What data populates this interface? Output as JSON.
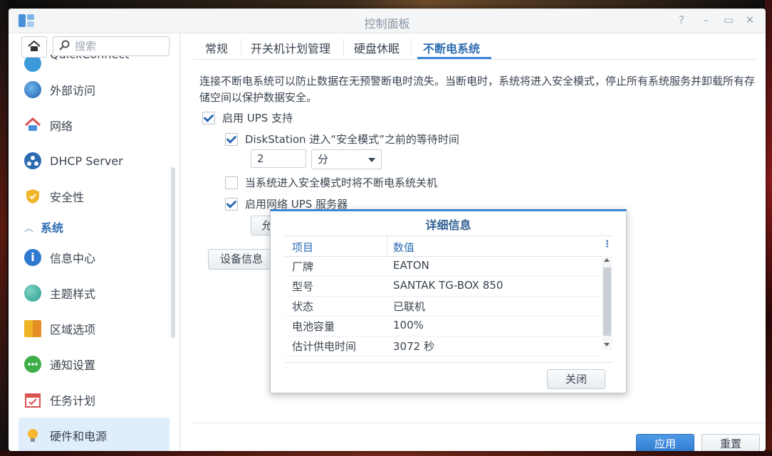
{
  "window": {
    "title": "控制面板"
  },
  "search": {
    "placeholder": "搜索"
  },
  "sidebar": {
    "partial_label": "QuickConnect",
    "items": [
      {
        "label": "外部访问",
        "icon": "globe-icon"
      },
      {
        "label": "网络",
        "icon": "house-network-icon"
      },
      {
        "label": "DHCP Server",
        "icon": "dhcp-icon"
      },
      {
        "label": "安全性",
        "icon": "shield-icon"
      }
    ],
    "section_label": "系统",
    "system_items": [
      {
        "label": "信息中心",
        "icon": "info-icon"
      },
      {
        "label": "主题样式",
        "icon": "palette-icon"
      },
      {
        "label": "区域选项",
        "icon": "region-icon"
      },
      {
        "label": "通知设置",
        "icon": "chat-bubble-icon"
      },
      {
        "label": "任务计划",
        "icon": "calendar-icon"
      },
      {
        "label": "硬件和电源",
        "icon": "lightbulb-icon",
        "active": true
      }
    ]
  },
  "tabs": [
    "常规",
    "开关机计划管理",
    "硬盘休眠",
    "不断电系统"
  ],
  "active_tab": "不断电系统",
  "main": {
    "description": "连接不断电系统可以防止数据在无预警断电时流失。当断电时，系统将进入安全模式，停止所有系统服务并卸载所有存储空间以保护数据安全。",
    "enable_ups": {
      "label": "启用 UPS 支持",
      "checked": true
    },
    "wait_time": {
      "label": "DiskStation 进入“安全模式”之前的等待时间",
      "checked": true,
      "value": "2",
      "unit": "分"
    },
    "shutdown_ups": {
      "label": "当系统进入安全模式时将不断电系统关机",
      "checked": false
    },
    "network_ups": {
      "label": "启用网络 UPS 服务器",
      "checked": true
    },
    "allow_button_partial": "允许",
    "device_info_button": "设备信息"
  },
  "footer": {
    "apply": "应用",
    "reset": "重置"
  },
  "dialog": {
    "title": "详细信息",
    "columns": [
      "项目",
      "数值"
    ],
    "rows": [
      {
        "key": "厂牌",
        "value": "EATON"
      },
      {
        "key": "型号",
        "value": "SANTAK TG-BOX 850"
      },
      {
        "key": "状态",
        "value": "已联机"
      },
      {
        "key": "电池容量",
        "value": "100%"
      },
      {
        "key": "估计供电时间",
        "value": "3072 秒"
      }
    ],
    "close": "关闭"
  },
  "colors": {
    "accent": "#3b86d6",
    "primary_button": "#2f79cf",
    "active_nav_bg": "#e0eefb"
  }
}
